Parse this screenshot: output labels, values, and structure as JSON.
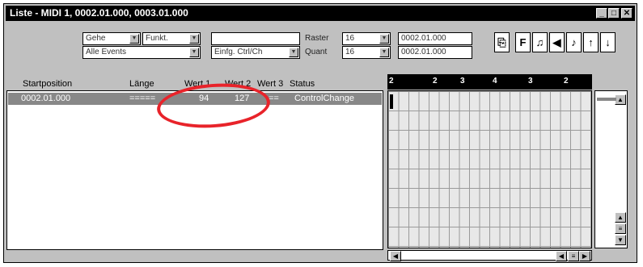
{
  "window": {
    "title": "Liste - MIDI 1, 0002.01.000, 0003.01.000",
    "minimize_label": "_",
    "maximize_label": "□",
    "close_label": "✕"
  },
  "toolbar": {
    "goto_label": "Gehe",
    "function_label": "Funkt.",
    "empty_field": "",
    "filter_label": "Alle Events",
    "insert_label": "Einfg. Ctrl/Ch",
    "raster_label": "Raster",
    "raster_value": "16",
    "quant_label": "Quant",
    "quant_value": "16",
    "start_position": "0002.01.000",
    "end_position": "0002.01.000",
    "buttons": [
      "F",
      "♫",
      "◀",
      "♪",
      "↑",
      "↓"
    ]
  },
  "list": {
    "headers": [
      "Startposition",
      "Länge",
      "Wert 1",
      "Wert 2",
      "Wert 3",
      "Status"
    ],
    "rows": [
      {
        "start": "0002.01.000",
        "length": "=====",
        "value1": "94",
        "value2": "127",
        "value3": "==",
        "status": "ControlChange"
      }
    ]
  },
  "ruler": {
    "ticks": [
      "2",
      "2",
      "3",
      "4",
      "3",
      "2"
    ]
  },
  "annotation_color": "#e8232a"
}
